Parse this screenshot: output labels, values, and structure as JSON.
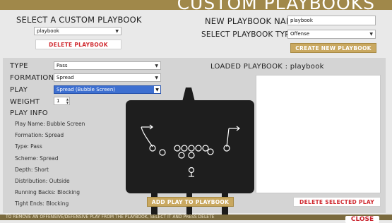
{
  "header": {
    "title": "CUSTOM PLAYBOOKS"
  },
  "select_playbook": {
    "label": "SELECT A CUSTOM PLAYBOOK",
    "value": "playbook",
    "delete_label": "DELETE PLAYBOOK"
  },
  "new_playbook": {
    "name_label": "NEW PLAYBOOK NAME",
    "name_value": "playbook",
    "type_label": "SELECT PLAYBOOK TYPE",
    "type_value": "Offense",
    "create_label": "CREATE NEW PLAYBOOK"
  },
  "form": {
    "type_label": "TYPE",
    "type_value": "Pass",
    "formation_label": "FORMATION",
    "formation_value": "Spread",
    "play_label": "PLAY",
    "play_value": "Spread (Bubble Screen)",
    "weight_label": "WEIGHT",
    "weight_value": "1"
  },
  "play_info": {
    "heading": "PLAY INFO",
    "lines": [
      "Play Name: Bubble Screen",
      "Formation: Spread",
      "Type: Pass",
      "Scheme: Spread",
      "Depth: Short",
      "Distribution: Outside",
      "Running Backs: Blocking",
      "Tight Ends: Blocking"
    ]
  },
  "loaded": {
    "label": "LOADED PLAYBOOK :",
    "name": "playbook"
  },
  "buttons": {
    "add_play": "ADD PLAY TO PLAYBOOK",
    "delete_play": "DELETE SELECTED PLAY",
    "close": "CLOSE"
  },
  "footer": {
    "text": "TO REMOVE AN OFFENSIVE/DEFENSIVE PLAY FROM THE PLAYBOOK, SELECT IT AND PRESS DELETE"
  },
  "colors": {
    "gold": "#c9a860",
    "red_text": "#d02a30",
    "chalkboard": "#1e1e1e",
    "highlight": "#3d6fd0"
  },
  "icons": {
    "dropdown": "chevron-down-icon",
    "spinner": "spinner-arrows-icon"
  }
}
